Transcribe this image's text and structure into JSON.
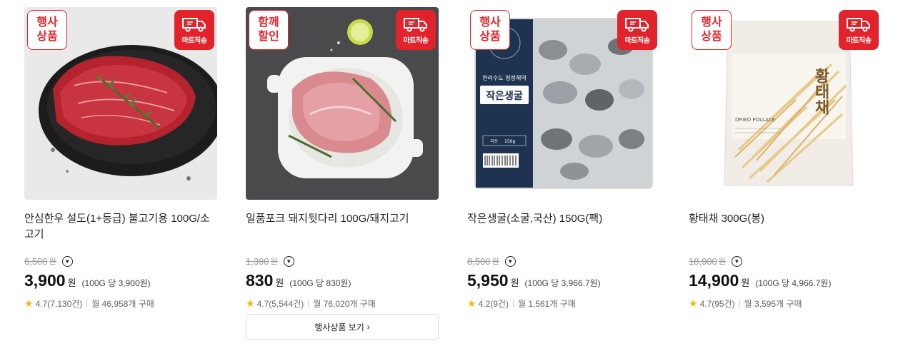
{
  "products": [
    {
      "badge": [
        "행사",
        "상품"
      ],
      "delivery_label": "마트직송",
      "title": "안심한우 설도(1+등급) 불고기용 100G/소고기",
      "original_price": "6,500",
      "won": "원",
      "price": "3,900",
      "unit_price": "(100G 당 3,900원)",
      "rating": "4.7(7,130건)",
      "purchases": "월 46,958개 구매"
    },
    {
      "badge": [
        "함께",
        "할인"
      ],
      "delivery_label": "마트직송",
      "title": "일품포크 돼지뒷다리 100G/돼지고기",
      "original_price": "1,390",
      "won": "원",
      "price": "830",
      "unit_price": "(100G 당 830원)",
      "rating": "4.7(5,544건)",
      "purchases": "월 76,020개 구매"
    },
    {
      "badge": [
        "행사",
        "상품"
      ],
      "delivery_label": "마트직송",
      "title": "작은생굴(소굴,국산) 150G(팩)",
      "original_price": "8,500",
      "won": "원",
      "price": "5,950",
      "unit_price": "(100G 당 3,966.7원)",
      "rating": "4.2(9건)",
      "purchases": "월 1,561개 구매",
      "package_text": {
        "region": "한려수도 청정해역",
        "name": "작은생굴",
        "origin": "국산",
        "weight": "150g"
      }
    },
    {
      "badge": [
        "행사",
        "상품"
      ],
      "delivery_label": "마트직송",
      "title": "황태채 300G(봉)",
      "original_price": "18,900",
      "won": "원",
      "price": "14,900",
      "unit_price": "(100G 당 4,966.7원)",
      "rating": "4.7(95건)",
      "purchases": "월 3,595개 구매",
      "package_text": {
        "name": "황태채",
        "english": "DRIED POLLACK"
      }
    }
  ],
  "view_button": {
    "label": "행사상품 보기",
    "chevron": "›"
  },
  "icons": {
    "star": "star-icon",
    "info": "chevron-down-circle-icon",
    "truck": "truck-icon"
  },
  "colors": {
    "accent": "#e3232b",
    "star": "#f5b800"
  }
}
